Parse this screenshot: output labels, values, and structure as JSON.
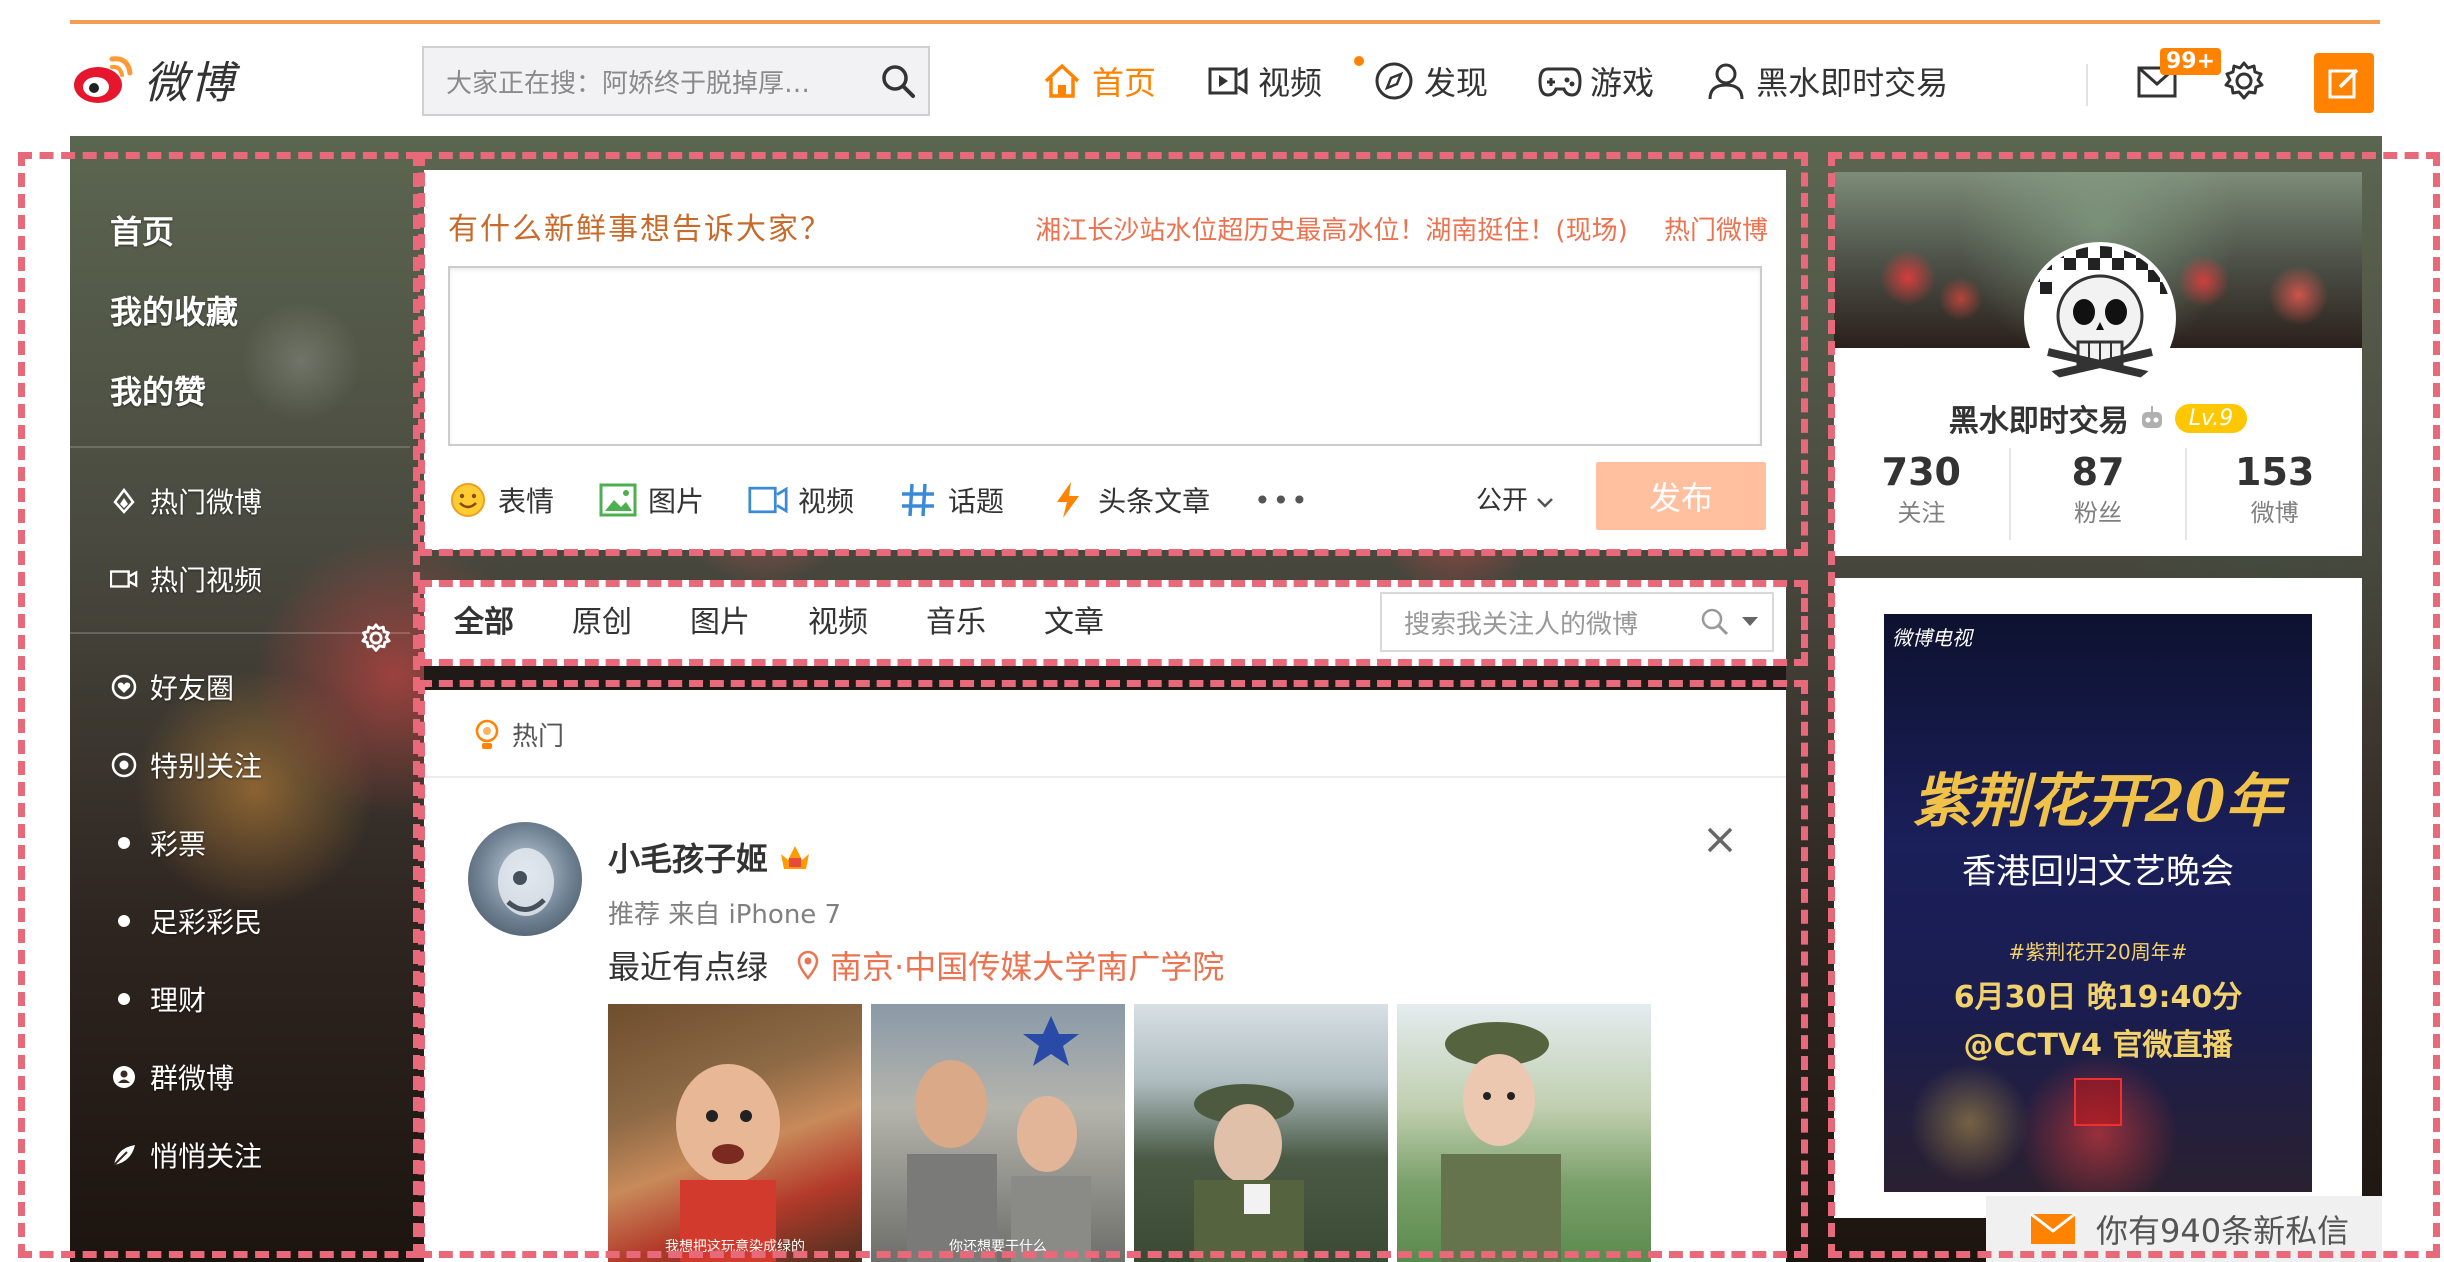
{
  "navbar": {
    "logo_text": "微博",
    "search_placeholder": "大家正在搜：阿娇终于脱掉厚…",
    "links": [
      {
        "label": "首页",
        "icon": "home-icon"
      },
      {
        "label": "视频",
        "icon": "video-icon"
      },
      {
        "label": "发现",
        "icon": "compass-icon"
      },
      {
        "label": "游戏",
        "icon": "gamepad-icon"
      },
      {
        "label": "黑水即时交易",
        "icon": "user-icon"
      }
    ],
    "message_badge": "99+",
    "accent_color": "#ff8200"
  },
  "sidebar": {
    "top_items": [
      "首页",
      "我的收藏",
      "我的赞"
    ],
    "mid_items": [
      {
        "label": "热门微博",
        "icon": "fire-icon"
      },
      {
        "label": "热门视频",
        "icon": "video-icon"
      }
    ],
    "low_items": [
      {
        "label": "好友圈",
        "icon": "heart-circle-icon"
      },
      {
        "label": "特别关注",
        "icon": "eye-circle-icon"
      },
      {
        "label": "彩票",
        "icon": "dot-icon"
      },
      {
        "label": "足彩彩民",
        "icon": "dot-icon"
      },
      {
        "label": "理财",
        "icon": "dot-icon"
      },
      {
        "label": "群微博",
        "icon": "group-icon"
      },
      {
        "label": "悄悄关注",
        "icon": "leaf-icon"
      }
    ]
  },
  "composer": {
    "heading": "有什么新鲜事想告诉大家？",
    "hot_topic": "湘江长沙站水位超历史最高水位！湖南挺住！(现场)",
    "hot_link": "热门微博",
    "tools": [
      {
        "label": "表情",
        "icon": "smile-icon"
      },
      {
        "label": "图片",
        "icon": "image-icon"
      },
      {
        "label": "视频",
        "icon": "video-icon"
      },
      {
        "label": "话题",
        "icon": "hashtag-icon"
      },
      {
        "label": "头条文章",
        "icon": "lightning-icon"
      }
    ],
    "more": "•••",
    "visibility": "公开",
    "publish": "发布"
  },
  "filter": {
    "tabs": [
      "全部",
      "原创",
      "图片",
      "视频",
      "音乐",
      "文章"
    ],
    "search_placeholder": "搜索我关注人的微博"
  },
  "feed": {
    "section_label": "热门",
    "post": {
      "author": "小毛孩子姬",
      "meta": "推荐 来自 iPhone 7",
      "text": "最近有点绿",
      "location": "南京·中国传媒大学南广学院",
      "image_captions": [
        "我想把这玩意染成绿的",
        "你还想要干什么",
        "",
        ""
      ]
    }
  },
  "profile": {
    "name": "黑水即时交易",
    "level": "Lv.9",
    "stats": [
      {
        "num": "730",
        "label": "关注"
      },
      {
        "num": "87",
        "label": "粉丝"
      },
      {
        "num": "153",
        "label": "微博"
      }
    ]
  },
  "ad": {
    "brand": "微博电视",
    "title": "紫荆花开20年",
    "subtitle": "香港回归文艺晚会",
    "hashtag": "#紫荆花开20周年#",
    "time": "6月30日 晚19:40分",
    "live": "@CCTV4 官微直播"
  },
  "pm_toast": {
    "text": "你有940条新私信"
  }
}
